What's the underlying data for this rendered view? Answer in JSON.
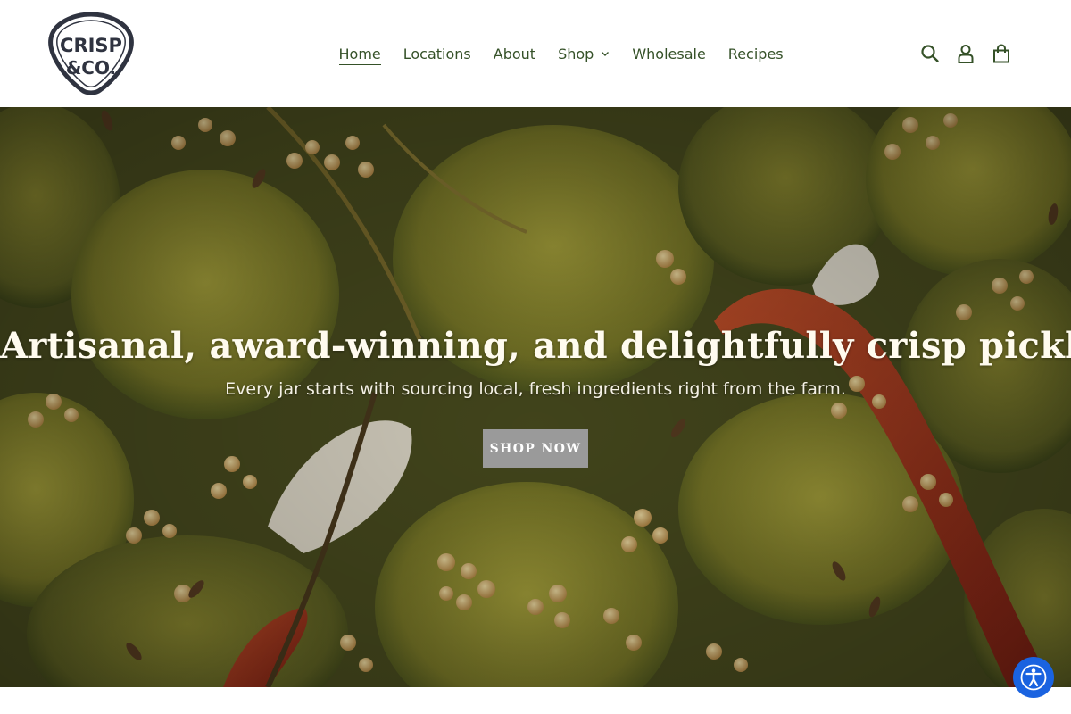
{
  "brand": {
    "name": "Crisp & Co.",
    "logo_line1": "CRISP",
    "logo_line2": "&CO."
  },
  "nav": {
    "items": [
      {
        "label": "Home",
        "active": true
      },
      {
        "label": "Locations"
      },
      {
        "label": "About"
      },
      {
        "label": "Shop",
        "dropdown": true
      },
      {
        "label": "Wholesale"
      },
      {
        "label": "Recipes"
      }
    ]
  },
  "header_icons": [
    "search-icon",
    "account-icon",
    "cart-icon"
  ],
  "hero": {
    "title": "Artisanal, award-winning, and delightfully crisp pickles.",
    "subtitle": "Every jar starts with sourcing local, fresh ingredients right from the farm.",
    "button_label": "SHOP NOW"
  },
  "accessibility": {
    "icon": "accessibility-icon"
  },
  "colors": {
    "nav_text": "#355128",
    "button_bg": "#9a9a9a",
    "accessibility_bg": "#1a63e0",
    "logo": "#2f3340"
  }
}
